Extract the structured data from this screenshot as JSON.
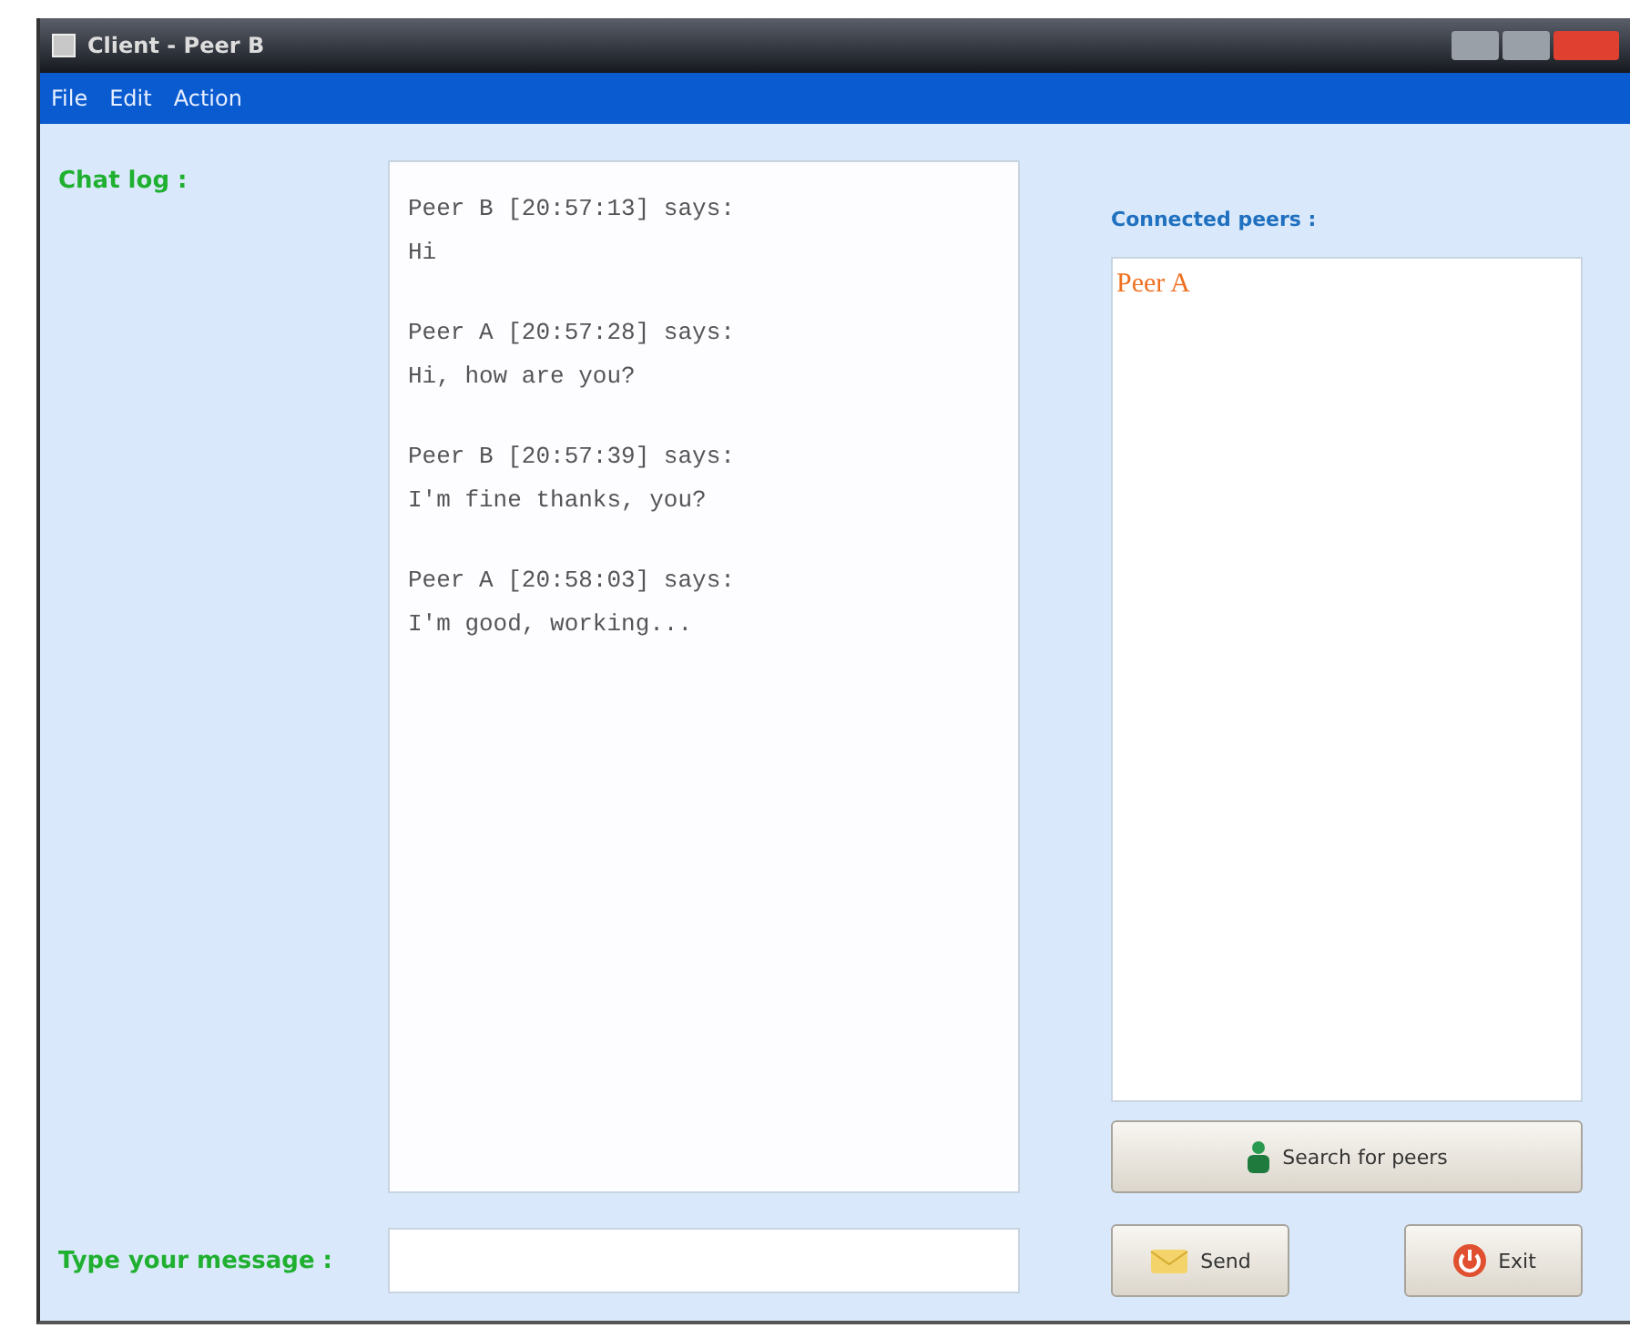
{
  "window": {
    "title": "Client - Peer B"
  },
  "menu": [
    "File",
    "Edit",
    "Action"
  ],
  "chat_log": {
    "label": "Chat log :",
    "messages": [
      {
        "header": "Peer B [20:57:13] says:",
        "text": "Hi"
      },
      {
        "header": "Peer A [20:57:28] says:",
        "text": "Hi, how are you?"
      },
      {
        "header": "Peer B [20:57:39] says:",
        "text": "I'm fine thanks, you?"
      },
      {
        "header": "Peer A [20:58:03] says:",
        "text": "I'm good, working..."
      }
    ]
  },
  "message": {
    "label": "Type your message :"
  },
  "peers": {
    "label": "Connected peers :",
    "items": [
      {
        "name": "Peer A"
      }
    ]
  },
  "buttons": {
    "search": "Search for peers",
    "send": "Send",
    "exit": "Exit"
  }
}
